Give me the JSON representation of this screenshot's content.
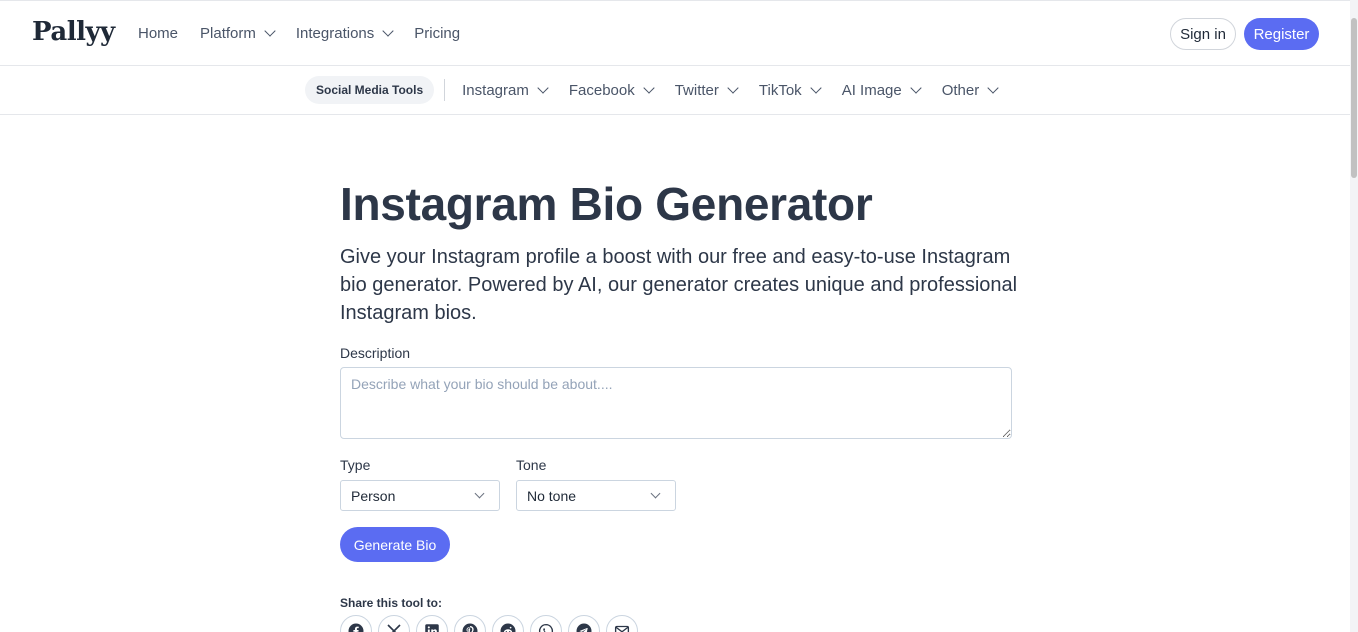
{
  "brand": {
    "logo": "Pallyy"
  },
  "nav": {
    "items": [
      {
        "label": "Home",
        "dropdown": false
      },
      {
        "label": "Platform",
        "dropdown": true
      },
      {
        "label": "Integrations",
        "dropdown": true
      },
      {
        "label": "Pricing",
        "dropdown": false
      }
    ],
    "signin": "Sign in",
    "register": "Register"
  },
  "subnav": {
    "active": "Social Media Tools",
    "items": [
      "Instagram",
      "Facebook",
      "Twitter",
      "TikTok",
      "AI Image",
      "Other"
    ]
  },
  "page": {
    "title": "Instagram Bio Generator",
    "description": "Give your Instagram profile a boost with our free and easy-to-use Instagram bio generator. Powered by AI, our generator creates unique and professional Instagram bios."
  },
  "form": {
    "description_label": "Description",
    "description_placeholder": "Describe what your bio should be about....",
    "type_label": "Type",
    "type_value": "Person",
    "tone_label": "Tone",
    "tone_value": "No tone",
    "generate_label": "Generate Bio"
  },
  "share": {
    "label": "Share this tool to:",
    "icons": [
      "facebook-icon",
      "x-icon",
      "linkedin-icon",
      "pinterest-icon",
      "reddit-icon",
      "whatsapp-icon",
      "telegram-icon",
      "email-icon"
    ]
  },
  "colors": {
    "accent": "#5b6cf2",
    "text": "#2d3748",
    "muted": "#4a5568",
    "border": "#cbd5e0"
  }
}
